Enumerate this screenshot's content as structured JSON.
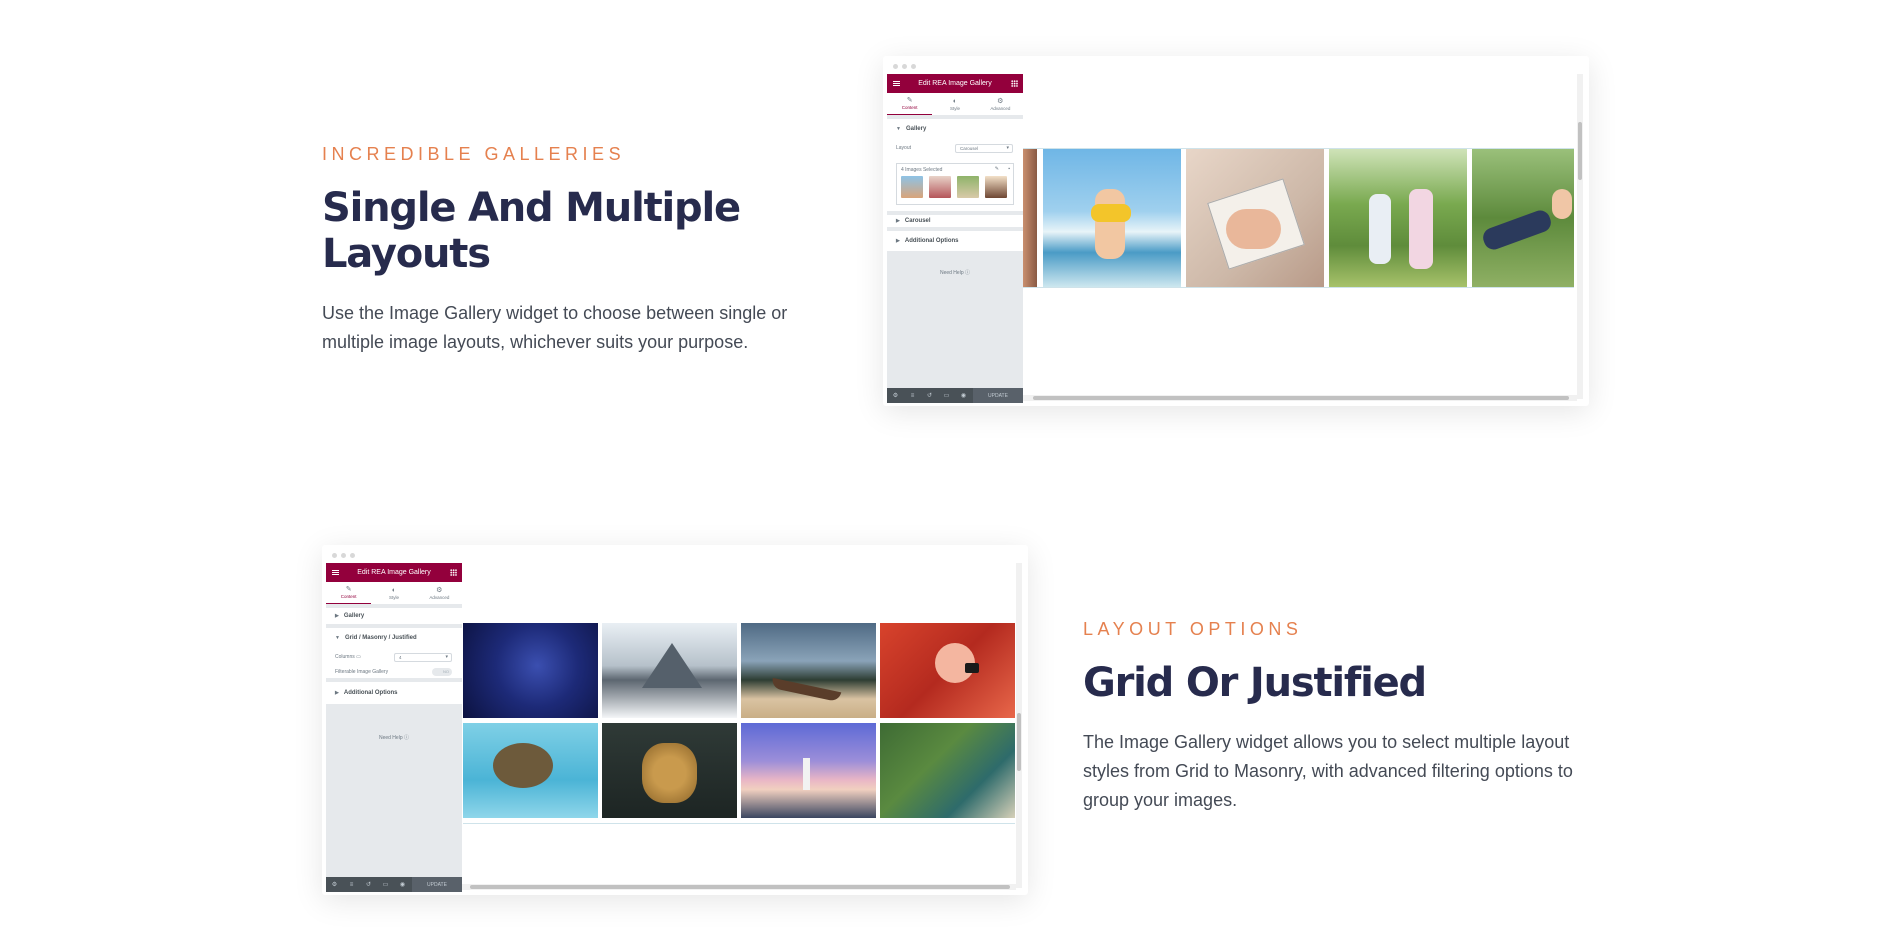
{
  "section1": {
    "eyebrow": "INCREDIBLE GALLERIES",
    "heading": "Single And Multiple Layouts",
    "description": "Use the Image Gallery widget to choose between single or multiple image layouts, whichever suits your purpose."
  },
  "section2": {
    "eyebrow": "LAYOUT OPTIONS",
    "heading": "Grid Or Justified",
    "description": "The Image Gallery widget allows you to select multiple layout styles from Grid to Masonry, with advanced filtering options to group your images."
  },
  "editor1": {
    "title": "Edit REA Image Gallery",
    "tabs": [
      "Content",
      "Style",
      "Advanced"
    ],
    "gallery_section": "Gallery",
    "layout_label": "Layout",
    "layout_value": "Carousel",
    "images_selected": "4 Images Selected",
    "carousel_section": "Carousel",
    "additional_section": "Additional Options",
    "need_help": "Need Help",
    "update_label": "UPDATE"
  },
  "editor2": {
    "title": "Edit REA Image Gallery",
    "tabs": [
      "Content",
      "Style",
      "Advanced"
    ],
    "gallery_section": "Gallery",
    "grid_section": "Grid / Masonry / Justified",
    "columns_label": "Columns",
    "columns_value": "4",
    "filterable_label": "Filterable Image Gallery",
    "filterable_toggle": "NO",
    "additional_section": "Additional Options",
    "need_help": "Need Help",
    "update_label": "UPDATE"
  },
  "colors": {
    "accent": "#e5814f",
    "heading": "#272b4d",
    "editor_brand": "#93003c"
  }
}
